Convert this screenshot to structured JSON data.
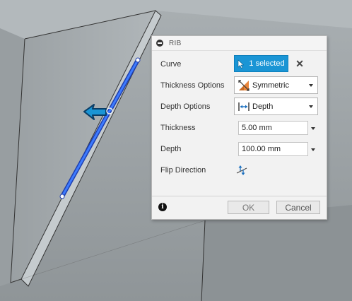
{
  "dialog": {
    "title": "RIB",
    "curve": {
      "label": "Curve",
      "selection": "1 selected"
    },
    "thickness_options": {
      "label": "Thickness Options",
      "value": "Symmetric"
    },
    "depth_options": {
      "label": "Depth Options",
      "value": "Depth"
    },
    "thickness": {
      "label": "Thickness",
      "value": "5.00 mm"
    },
    "depth": {
      "label": "Depth",
      "value": "100.00 mm"
    },
    "flip_direction": {
      "label": "Flip Direction"
    },
    "ok_label": "OK",
    "cancel_label": "Cancel"
  },
  "colors": {
    "accent": "#1a95d5",
    "selected_edge": "#2a5bd7",
    "viewport_bg": "#9da3a6"
  }
}
